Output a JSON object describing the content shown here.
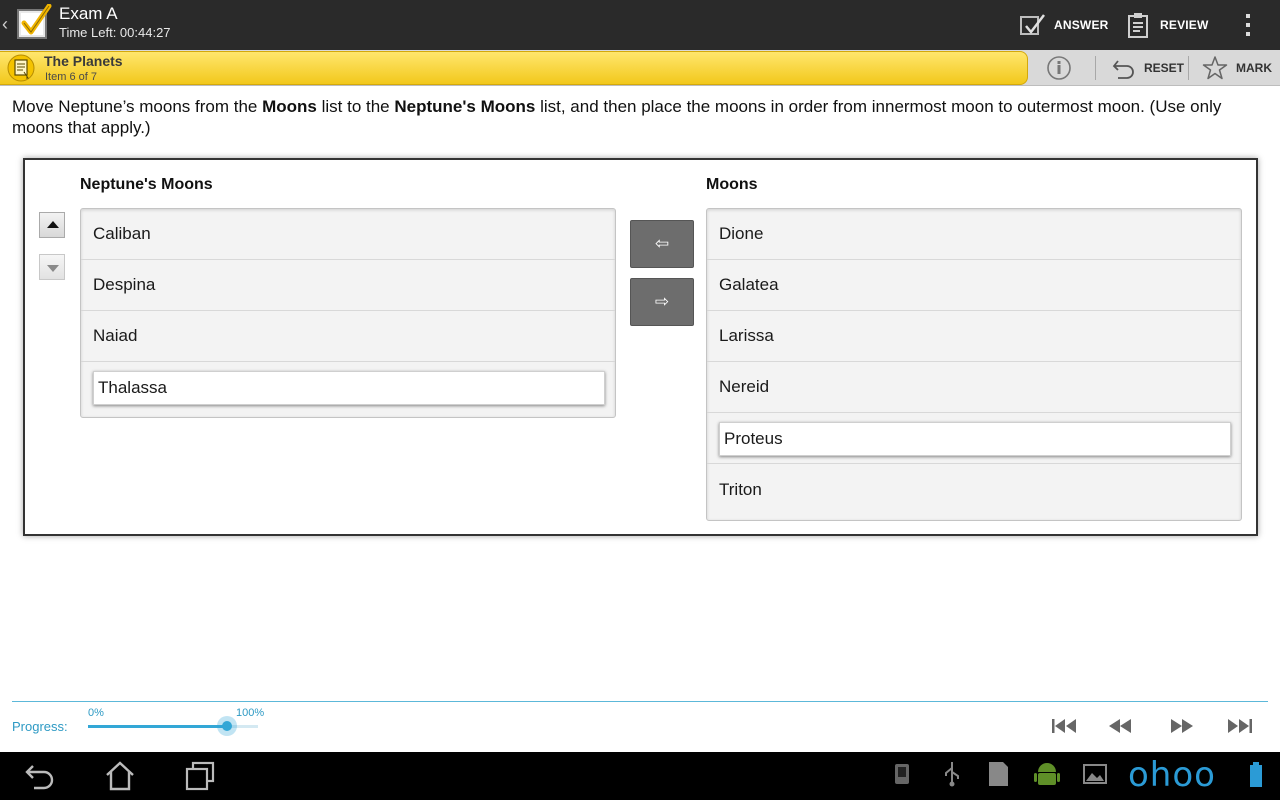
{
  "header": {
    "title": "Exam A",
    "timer": "Time Left: 00:44:27",
    "answer_label": "ANSWER",
    "review_label": "REVIEW",
    "icons": {
      "app": "checkbox-app-icon",
      "answer": "answer-icon",
      "review": "review-clipboard-icon",
      "overflow": "overflow-menu-icon"
    }
  },
  "item_bar": {
    "title": "The Planets",
    "subtitle": "Item 6 of 7",
    "reset_label": "RESET",
    "mark_label": "MARK",
    "accent_color": "#f2c81b"
  },
  "question": {
    "p1": "Move Neptune’s moons from the ",
    "b1": "Moons",
    "p2": " list to the ",
    "b2": "Neptune's Moons",
    "p3": " list, and then place the moons in order from innermost moon to outermost moon. (Use only moons that apply.)"
  },
  "lists": {
    "target_label": "Neptune's Moons",
    "source_label": "Moons",
    "target_items": [
      "Caliban",
      "Despina",
      "Naiad",
      "Thalassa"
    ],
    "target_selected": "Thalassa",
    "source_items": [
      "Dione",
      "Galatea",
      "Larissa",
      "Nereid",
      "Proteus",
      "Triton"
    ],
    "source_selected": "Proteus",
    "move_left_glyph": "⇦",
    "move_right_glyph": "⇨"
  },
  "footer": {
    "progress_label": "Progress:",
    "min_label": "0%",
    "max_label": "100%",
    "progress_fraction": 0.82,
    "accent_color": "#33a7d6"
  },
  "system_bar": {
    "brand": "ohoo"
  }
}
